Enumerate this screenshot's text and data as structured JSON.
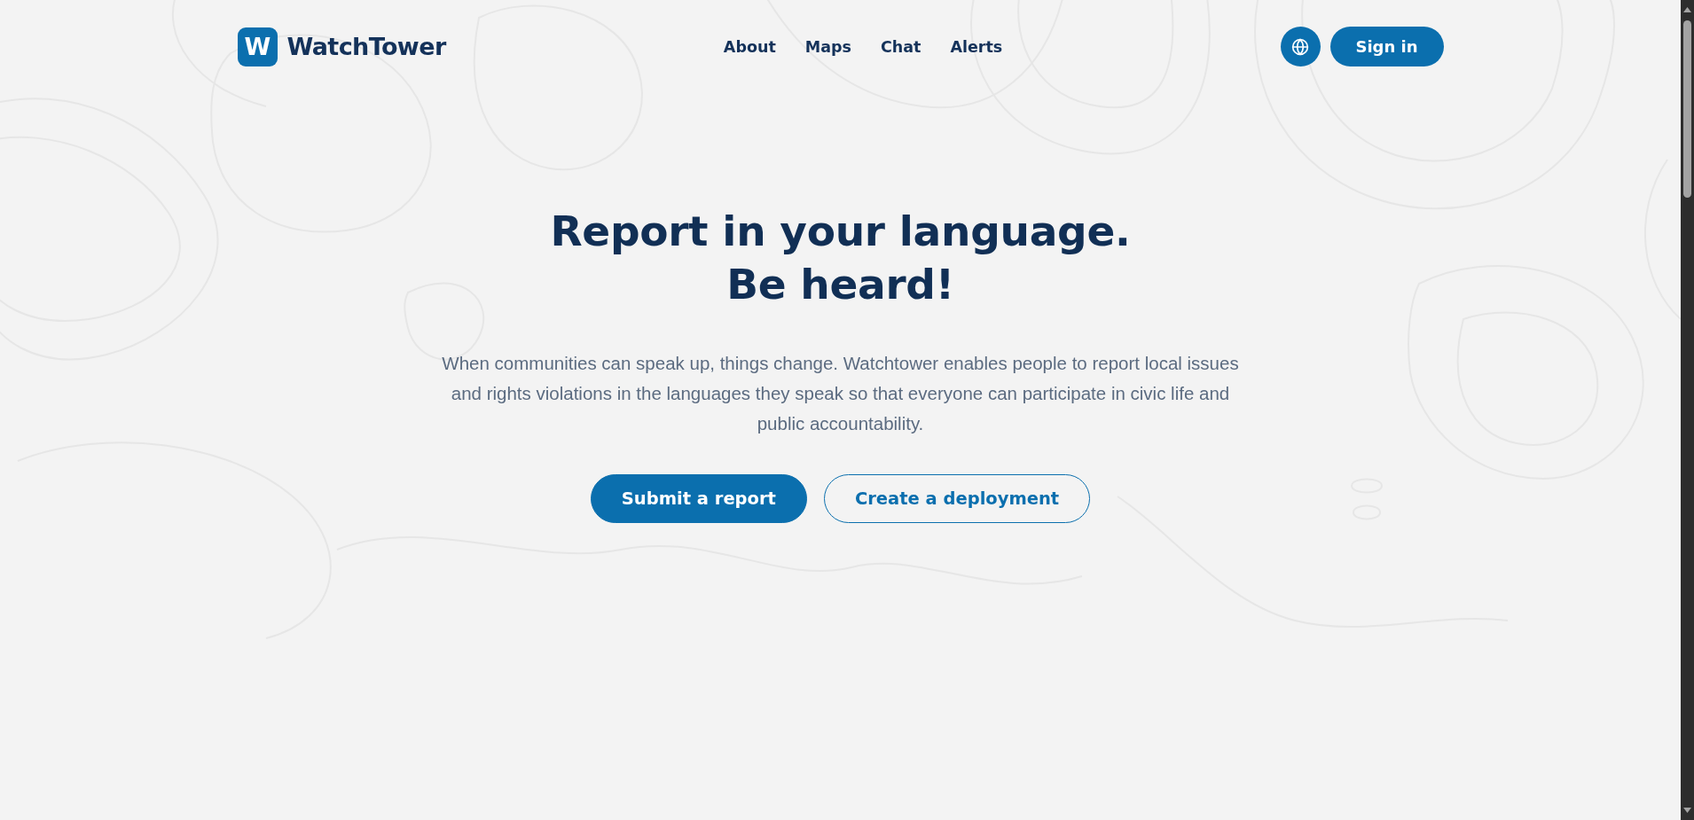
{
  "header": {
    "logo": {
      "mark": "W",
      "name": "WatchTower"
    },
    "nav": [
      {
        "label": "About"
      },
      {
        "label": "Maps"
      },
      {
        "label": "Chat"
      },
      {
        "label": "Alerts"
      }
    ],
    "sign_in": "Sign in"
  },
  "hero": {
    "title_lines": [
      "Report in your language.",
      "Be heard!"
    ],
    "description": "When communities can speak up, things change. Watchtower enables people to report local issues and rights violations in the languages they speak so that everyone can participate in civic life and public accountability.",
    "actions": [
      {
        "label": "Submit a report",
        "kind": "primary"
      },
      {
        "label": "Create a deployment",
        "kind": "secondary"
      }
    ]
  }
}
